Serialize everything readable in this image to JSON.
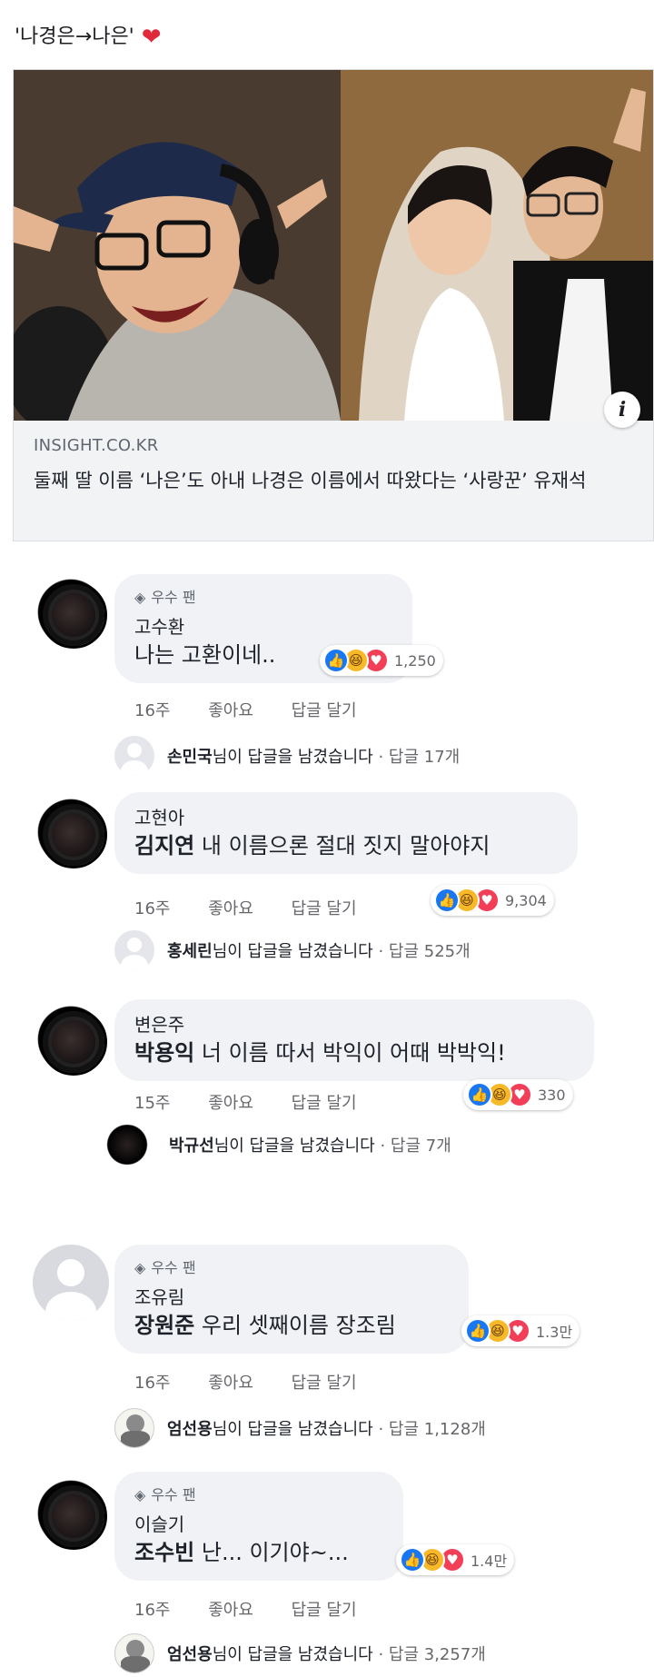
{
  "post": {
    "text": "'나경은→나은'",
    "heart_icon": "heart-icon"
  },
  "link_card": {
    "domain": "INSIGHT.CO.KR",
    "title": "둘째 딸 이름 ‘나은’도 아내 나경은 이름에서 따왔다는 ‘사랑꾼’ 유재석",
    "info_glyph": "i"
  },
  "labels": {
    "top_fan": "우수 팬",
    "like": "좋아요",
    "reply": "답글 달기"
  },
  "comments": [
    {
      "author": "고수환",
      "top_fan": true,
      "tag": "",
      "text": "나는 고환이네..",
      "reactions": "1,250",
      "age": "16주",
      "reply_name": "손민국",
      "reply_suffix": "님이 답글을 남겼습니다",
      "reply_count": " · 답글 17개"
    },
    {
      "author": "고현아",
      "top_fan": false,
      "tag": "김지연",
      "text": " 내 이름으론 절대 짓지 말아야지",
      "reactions": "9,304",
      "age": "16주",
      "reply_name": "홍세린",
      "reply_suffix": "님이 답글을 남겼습니다",
      "reply_count": " · 답글 525개"
    },
    {
      "author": "변은주",
      "top_fan": false,
      "tag": "박용익",
      "text": " 너 이름 따서 박익이 어때 박박익!",
      "reactions": "330",
      "age": "15주",
      "reply_name": "박규선",
      "reply_suffix": "님이 답글을 남겼습니다",
      "reply_count": " · 답글 7개"
    },
    {
      "author": "조유림",
      "top_fan": true,
      "tag": "장원준",
      "text": " 우리 셋째이름 장조림",
      "reactions": "1.3만",
      "age": "16주",
      "reply_name": "엄선용",
      "reply_suffix": "님이 답글을 남겼습니다",
      "reply_count": " · 답글 1,128개"
    },
    {
      "author": "이슬기",
      "top_fan": true,
      "tag": "조수빈",
      "text": " 난... 이기야~...",
      "reactions": "1.4만",
      "age": "16주",
      "reply_name": "엄선용",
      "reply_suffix": "님이 답글을 남겼습니다",
      "reply_count": " · 답글 3,257개"
    }
  ],
  "colors": {
    "bubble": "#f0f2f5",
    "like": "#1877f2",
    "haha": "#f7b928",
    "love": "#f33e58"
  }
}
